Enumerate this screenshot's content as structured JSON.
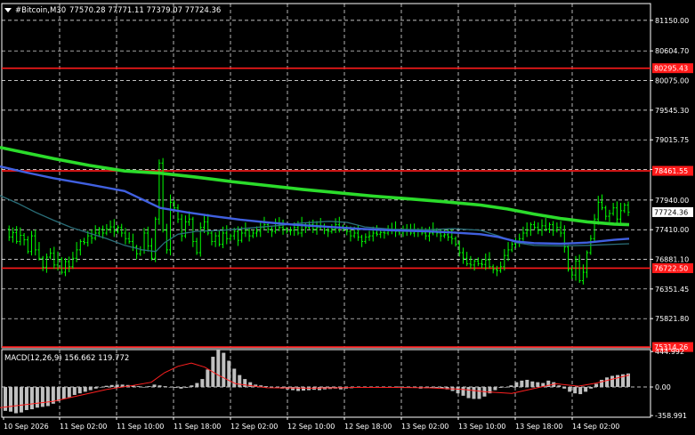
{
  "header": {
    "symbol": "#Bitcoin,M30",
    "ohlc": "77570.28 77771.11 77379.07 77724.36"
  },
  "macd_header": "MACD(12,26,9) 156.662 119.772",
  "colors": {
    "background": "#000000",
    "grid": "#ffffff",
    "bull_bar": "#00ff00",
    "ma_fast": "#2bdc2b",
    "ma_mid": "#4060e0",
    "ma_slow": "#2a6f7a",
    "level": "#ff1a1a",
    "price_tag": "#ffffff",
    "macd_hist": "#c0c0c0",
    "macd_signal": "#ff2020"
  },
  "chart_data": [
    {
      "type": "line",
      "title": "#Bitcoin,M30",
      "y_ticks": [
        81150.0,
        80604.7,
        80075.0,
        79545.3,
        79015.75,
        78486.1,
        77940.0,
        77410.0,
        76881.1,
        76351.45,
        75821.8
      ],
      "ylim": [
        75300,
        81450
      ],
      "x_ticks": [
        "10 Sep 2026",
        "11 Sep 02:00",
        "11 Sep 10:00",
        "11 Sep 18:00",
        "12 Sep 02:00",
        "12 Sep 10:00",
        "12 Sep 18:00",
        "13 Sep 02:00",
        "13 Sep 10:00",
        "13 Sep 18:00",
        "14 Sep 02:00"
      ],
      "last_price": 77724.36,
      "levels": [
        {
          "label": "80295.43",
          "value": 80295.43
        },
        {
          "label": "78461.55",
          "value": 78461.55
        },
        {
          "label": "76722.50",
          "value": 76722.5
        },
        {
          "label": "75314.26",
          "value": 75314.26
        }
      ],
      "closes": [
        77420,
        77280,
        77360,
        77200,
        77310,
        77230,
        77020,
        77300,
        77050,
        76900,
        76740,
        76920,
        76990,
        76780,
        76880,
        76650,
        76840,
        76750,
        76900,
        77050,
        77200,
        77180,
        77300,
        77260,
        77350,
        77420,
        77350,
        77420,
        77460,
        77380,
        77450,
        77350,
        77250,
        77200,
        77100,
        76980,
        77050,
        77350,
        77120,
        76900,
        77600,
        78600,
        77400,
        77050,
        77900,
        77800,
        77600,
        77300,
        77550,
        77600,
        77200,
        77000,
        77450,
        77550,
        77350,
        77200,
        77300,
        77150,
        77350,
        77250,
        77300,
        77380,
        77220,
        77350,
        77400,
        77300,
        77350,
        77380,
        77450,
        77500,
        77420,
        77380,
        77520,
        77450,
        77420,
        77380,
        77400,
        77450,
        77350,
        77500,
        77450,
        77500,
        77420,
        77450,
        77480,
        77400,
        77380,
        77420,
        77500,
        77460,
        77420,
        77380,
        77300,
        77350,
        77280,
        77200,
        77280,
        77300,
        77350,
        77330,
        77360,
        77350,
        77400,
        77420,
        77380,
        77350,
        77420,
        77400,
        77350,
        77380,
        77400,
        77350,
        77300,
        77350,
        77400,
        77350,
        77300,
        77320,
        77280,
        77250,
        77150,
        77000,
        76900,
        76800,
        76780,
        76850,
        76800,
        76790,
        76870,
        76750,
        76700,
        76680,
        76750,
        76950,
        77050,
        77150,
        77200,
        77250,
        77350,
        77400,
        77500,
        77450,
        77400,
        77480,
        77420,
        77500,
        77400,
        77450,
        77350,
        77100,
        76700,
        76600,
        76850,
        76500,
        76650,
        77000,
        77250,
        77600,
        77900,
        77800,
        77650,
        77700,
        77800,
        77600,
        77750,
        77850,
        77724
      ],
      "ma_fast": [
        [
          0,
          78880
        ],
        [
          30,
          78780
        ],
        [
          60,
          78680
        ],
        [
          100,
          78560
        ],
        [
          140,
          78460
        ],
        [
          180,
          78420
        ],
        [
          220,
          78350
        ],
        [
          260,
          78270
        ],
        [
          300,
          78200
        ],
        [
          340,
          78130
        ],
        [
          380,
          78070
        ],
        [
          420,
          78010
        ],
        [
          460,
          77960
        ],
        [
          500,
          77910
        ],
        [
          540,
          77850
        ],
        [
          570,
          77780
        ],
        [
          600,
          77690
        ],
        [
          630,
          77610
        ],
        [
          660,
          77550
        ],
        [
          690,
          77510
        ],
        [
          707,
          77500
        ]
      ],
      "ma_mid": [
        [
          0,
          78540
        ],
        [
          30,
          78430
        ],
        [
          60,
          78330
        ],
        [
          100,
          78220
        ],
        [
          140,
          78100
        ],
        [
          160,
          77950
        ],
        [
          180,
          77800
        ],
        [
          210,
          77720
        ],
        [
          240,
          77650
        ],
        [
          270,
          77590
        ],
        [
          300,
          77540
        ],
        [
          330,
          77500
        ],
        [
          360,
          77470
        ],
        [
          400,
          77430
        ],
        [
          440,
          77400
        ],
        [
          480,
          77380
        ],
        [
          510,
          77360
        ],
        [
          540,
          77330
        ],
        [
          560,
          77280
        ],
        [
          580,
          77200
        ],
        [
          600,
          77170
        ],
        [
          630,
          77160
        ],
        [
          660,
          77180
        ],
        [
          690,
          77230
        ],
        [
          707,
          77250
        ]
      ],
      "ma_slow": [
        [
          0,
          78020
        ],
        [
          20,
          77880
        ],
        [
          40,
          77720
        ],
        [
          60,
          77580
        ],
        [
          80,
          77450
        ],
        [
          100,
          77350
        ],
        [
          120,
          77250
        ],
        [
          140,
          77130
        ],
        [
          160,
          77050
        ],
        [
          175,
          77020
        ],
        [
          185,
          77180
        ],
        [
          200,
          77330
        ],
        [
          220,
          77380
        ],
        [
          250,
          77400
        ],
        [
          280,
          77440
        ],
        [
          310,
          77480
        ],
        [
          340,
          77530
        ],
        [
          370,
          77560
        ],
        [
          390,
          77540
        ],
        [
          410,
          77460
        ],
        [
          440,
          77420
        ],
        [
          480,
          77410
        ],
        [
          510,
          77430
        ],
        [
          540,
          77400
        ],
        [
          560,
          77300
        ],
        [
          580,
          77180
        ],
        [
          600,
          77130
        ],
        [
          630,
          77120
        ],
        [
          660,
          77130
        ],
        [
          690,
          77150
        ],
        [
          707,
          77160
        ]
      ]
    },
    {
      "type": "bar",
      "title": "MACD(12,26,9)",
      "y_ticks": [
        444.992,
        0.0,
        -358.991
      ],
      "ylim": [
        -380,
        470
      ],
      "histogram": [
        -300,
        -310,
        -330,
        -320,
        -290,
        -280,
        -260,
        -250,
        -240,
        -210,
        -180,
        -150,
        -130,
        -100,
        -80,
        -60,
        -40,
        -20,
        0,
        15,
        25,
        30,
        30,
        25,
        20,
        10,
        0,
        10,
        30,
        20,
        10,
        0,
        -10,
        -20,
        -10,
        20,
        50,
        100,
        220,
        380,
        470,
        430,
        330,
        230,
        150,
        100,
        60,
        30,
        20,
        10,
        0,
        -10,
        -20,
        -30,
        -40,
        -50,
        -45,
        -40,
        -35,
        -40,
        -30,
        -25,
        -20,
        -30,
        -20,
        -15,
        -10,
        -10,
        -5,
        0,
        -5,
        -10,
        -5,
        0,
        5,
        0,
        -5,
        -10,
        -20,
        -15,
        -10,
        -10,
        -20,
        -30,
        -50,
        -80,
        -110,
        -140,
        -150,
        -150,
        -120,
        -80,
        -40,
        -10,
        0,
        20,
        60,
        80,
        90,
        70,
        60,
        50,
        80,
        60,
        20,
        -20,
        -60,
        -80,
        -90,
        -60,
        -20,
        40,
        90,
        120,
        140,
        150,
        160,
        170
      ],
      "signal": [
        [
          0,
          -260
        ],
        [
          60,
          -180
        ],
        [
          120,
          -30
        ],
        [
          150,
          20
        ],
        [
          170,
          60
        ],
        [
          185,
          180
        ],
        [
          200,
          260
        ],
        [
          215,
          300
        ],
        [
          230,
          250
        ],
        [
          245,
          150
        ],
        [
          265,
          40
        ],
        [
          300,
          -10
        ],
        [
          350,
          -15
        ],
        [
          400,
          -5
        ],
        [
          440,
          -5
        ],
        [
          480,
          -10
        ],
        [
          520,
          -30
        ],
        [
          545,
          -60
        ],
        [
          575,
          -80
        ],
        [
          600,
          -20
        ],
        [
          625,
          40
        ],
        [
          650,
          10
        ],
        [
          670,
          50
        ],
        [
          707,
          150
        ]
      ]
    }
  ]
}
